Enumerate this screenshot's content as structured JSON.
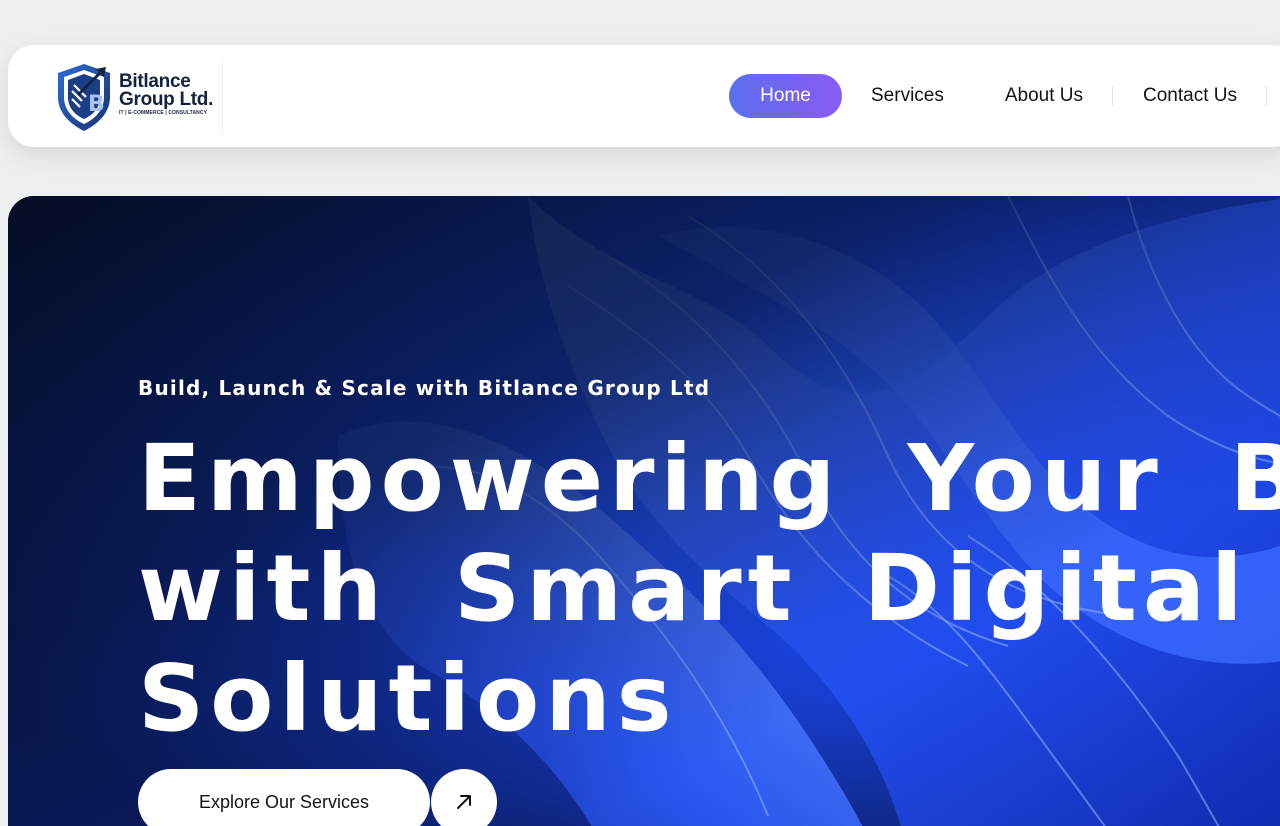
{
  "header": {
    "logo": {
      "name_line1": "Bitlance",
      "name_line2": "Group Ltd.",
      "subtitle": "IT | E-COMMERCE | CONSULTANCY"
    },
    "nav": [
      {
        "label": "Home",
        "active": true
      },
      {
        "label": "Services",
        "active": false
      },
      {
        "label": "About Us",
        "active": false
      },
      {
        "label": "Contact Us",
        "active": false
      }
    ]
  },
  "hero": {
    "tagline": "Build, Launch & Scale with Bitlance Group Ltd",
    "title_lines": [
      "Empowering Your B",
      "with Smart Digital",
      "Solutions"
    ],
    "cta_label": "Explore Our Services",
    "cta_icon": "arrow-up-right-icon"
  },
  "colors": {
    "nav_active_start": "#5b6ef0",
    "nav_active_end": "#8a5cf2",
    "hero_dark": "#061235",
    "hero_blue": "#1f4dff",
    "logo_navy": "#12233f"
  }
}
